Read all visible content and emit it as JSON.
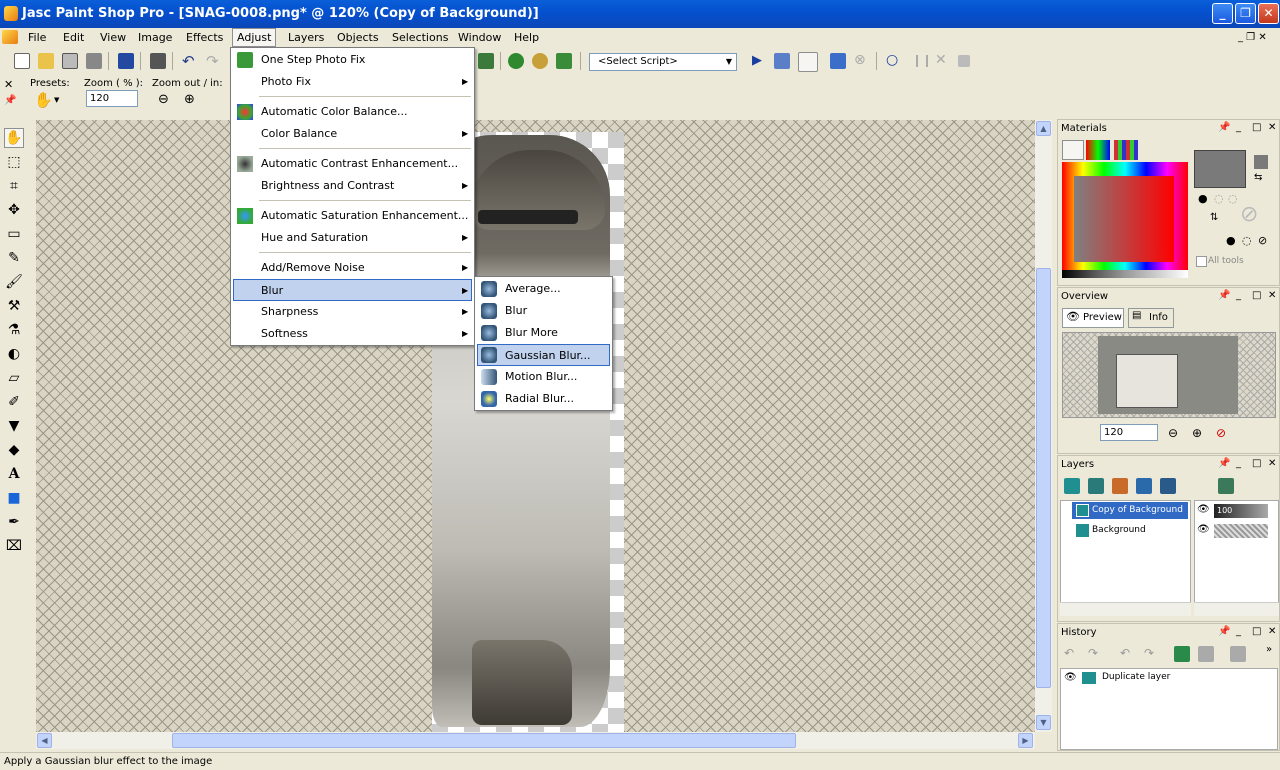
{
  "window": {
    "title": "Jasc Paint Shop Pro - [SNAG-0008.png* @ 120% (Copy of Background)]",
    "minimize": "_",
    "maximize": "❐",
    "close": "✕"
  },
  "menubar": {
    "items": [
      "File",
      "Edit",
      "View",
      "Image",
      "Effects",
      "Adjust",
      "Layers",
      "Objects",
      "Selections",
      "Window",
      "Help"
    ]
  },
  "toolbar": {
    "script_select": "<Select Script>",
    "presets_label": "Presets:",
    "zoom_label": "Zoom ( % ):",
    "zoom_value": "120",
    "zoomout_label": "Zoom out / in:"
  },
  "adjust_menu": {
    "items": [
      {
        "label": "One Step Photo Fix",
        "submenu": false
      },
      {
        "label": "Photo Fix",
        "submenu": true
      },
      {
        "label": "Automatic Color Balance...",
        "submenu": false
      },
      {
        "label": "Color Balance",
        "submenu": true
      },
      {
        "label": "Automatic Contrast Enhancement...",
        "submenu": false
      },
      {
        "label": "Brightness and Contrast",
        "submenu": true
      },
      {
        "label": "Automatic Saturation Enhancement...",
        "submenu": false
      },
      {
        "label": "Hue and Saturation",
        "submenu": true
      },
      {
        "label": "Add/Remove Noise",
        "submenu": true
      },
      {
        "label": "Blur",
        "submenu": true,
        "highlighted": true
      },
      {
        "label": "Sharpness",
        "submenu": true
      },
      {
        "label": "Softness",
        "submenu": true
      }
    ]
  },
  "blur_menu": {
    "items": [
      {
        "label": "Average..."
      },
      {
        "label": "Blur"
      },
      {
        "label": "Blur More"
      },
      {
        "label": "Gaussian Blur...",
        "highlighted": true
      },
      {
        "label": "Motion Blur..."
      },
      {
        "label": "Radial Blur..."
      }
    ]
  },
  "panels": {
    "materials": {
      "title": "Materials",
      "all_tools": "All tools"
    },
    "overview": {
      "title": "Overview",
      "tab_preview": "Preview",
      "tab_info": "Info",
      "zoom_value": "120"
    },
    "layers": {
      "title": "Layers",
      "items": [
        "Copy of Background",
        "Background"
      ],
      "opacity": "100"
    },
    "history": {
      "title": "History",
      "items": [
        "Duplicate layer"
      ]
    }
  },
  "status": {
    "text": "Apply a Gaussian blur effect to the image"
  },
  "colors": {
    "titlebar": "#0551d0",
    "highlight": "#c1d2ee",
    "highlight_border": "#316ac5"
  }
}
